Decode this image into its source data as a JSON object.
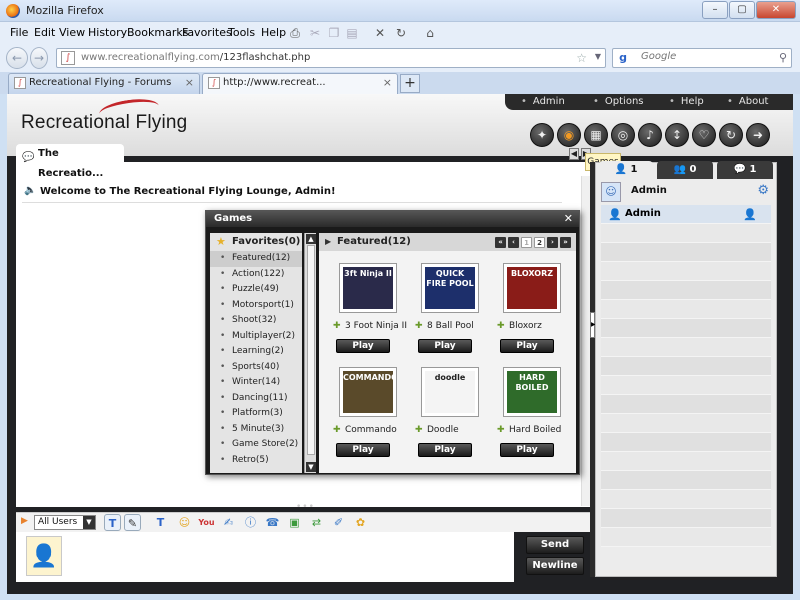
{
  "window": {
    "title": "Mozilla Firefox",
    "min": "–",
    "max": "▢",
    "close": "✕"
  },
  "menu": [
    "File",
    "Edit",
    "View",
    "History",
    "Bookmarks",
    "Favorites",
    "Tools",
    "Help"
  ],
  "nav": {
    "url_host": "www.recreationalflying.com",
    "url_path": "/123flashchat.php",
    "search_placeholder": "Google"
  },
  "browser_tabs": [
    {
      "label": "Recreational Flying - Forums"
    },
    {
      "label": "http://www.recreat..."
    }
  ],
  "site": {
    "logo": "Recreational Flying",
    "top_links": [
      "Admin",
      "Options",
      "Help",
      "About"
    ]
  },
  "chat": {
    "room_tab": "The Recreatio...",
    "welcome": "Welcome to The Recreational Flying Lounge, Admin!",
    "tooltip": "Games",
    "user_select": "All Users",
    "send": "Send",
    "newline": "Newline"
  },
  "right_panel": {
    "tabs": [
      {
        "count": "1"
      },
      {
        "count": "0"
      },
      {
        "count": "1"
      }
    ],
    "header_name": "Admin",
    "users": [
      {
        "name": "Admin"
      }
    ]
  },
  "games": {
    "title": "Games",
    "favorites": "Favorites(0)",
    "categories": [
      "Featured(12)",
      "Action(122)",
      "Puzzle(49)",
      "Motorsport(1)",
      "Shoot(32)",
      "Multiplayer(2)",
      "Learning(2)",
      "Sports(40)",
      "Winter(14)",
      "Dancing(11)",
      "Platform(3)",
      "5 Minute(3)",
      "Game Store(2)",
      "Retro(5)"
    ],
    "section": "Featured(12)",
    "pages": [
      "1",
      "2"
    ],
    "items": [
      {
        "name": "3 Foot Ninja II",
        "art": "3ft Ninja II",
        "color": "#2a2a4a"
      },
      {
        "name": "8 Ball Pool",
        "art": "QUICK FIRE POOL",
        "color": "#1d2f6b"
      },
      {
        "name": "Bloxorz",
        "art": "BLOXORZ",
        "color": "#8a1c18"
      },
      {
        "name": "Commando",
        "art": "COMMANDO",
        "color": "#5a4a2a"
      },
      {
        "name": "Doodle",
        "art": "doodle",
        "color": "#f4f4f4"
      },
      {
        "name": "Hard Boiled",
        "art": "HARD BOILED",
        "color": "#2f6b2a"
      }
    ],
    "play_label": "Play"
  }
}
